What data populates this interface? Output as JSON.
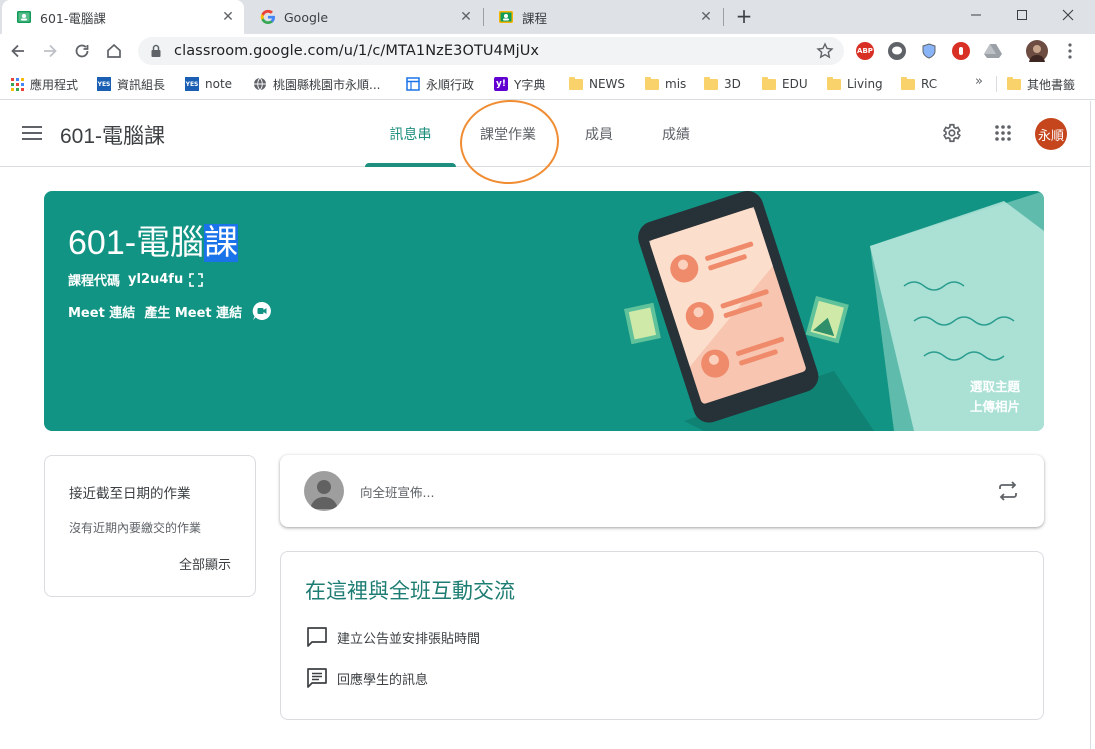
{
  "browser": {
    "tabs": [
      {
        "title": "601-電腦課",
        "active": true,
        "icon": "classroom-icon"
      },
      {
        "title": "Google",
        "active": false,
        "icon": "google-icon"
      },
      {
        "title": "課程",
        "active": false,
        "icon": "classroom-icon"
      }
    ],
    "url": "classroom.google.com/u/1/c/MTA1NzE3OTU4MjUx",
    "extensions": [
      "adblock-icon",
      "line-icon",
      "shield-extension-icon",
      "stop-extension-icon",
      "drive-icon",
      "profile-photo"
    ],
    "bookmarks": [
      {
        "label": "應用程式",
        "icon": "apps-grid-icon"
      },
      {
        "label": "資訊組長",
        "icon": "yes-icon"
      },
      {
        "label": "note",
        "icon": "yes-icon"
      },
      {
        "label": "桃園縣桃園市永順...",
        "icon": "globe-icon"
      },
      {
        "label": "永順行政",
        "icon": "window-icon"
      },
      {
        "label": "Y字典",
        "icon": "yahoo-icon"
      },
      {
        "label": "NEWS",
        "icon": "folder-icon"
      },
      {
        "label": "mis",
        "icon": "folder-icon"
      },
      {
        "label": "3D",
        "icon": "folder-icon"
      },
      {
        "label": "EDU",
        "icon": "folder-icon"
      },
      {
        "label": "Living",
        "icon": "folder-icon"
      },
      {
        "label": "RC",
        "icon": "folder-icon"
      }
    ],
    "more_bookmarks": "»",
    "other_bookmarks": "其他書籤"
  },
  "app": {
    "course_title": "601-電腦課",
    "tabs": [
      {
        "label": "訊息串",
        "active": true
      },
      {
        "label": "課堂作業",
        "active": false
      },
      {
        "label": "成員",
        "active": false
      },
      {
        "label": "成績",
        "active": false
      }
    ],
    "avatar_text": "永順"
  },
  "banner": {
    "title_prefix": "601-電腦",
    "title_highlight": "課",
    "code_label": "課程代碼",
    "code_value": "yl2u4fu",
    "meet_label": "Meet 連結",
    "meet_generate": "產生 Meet 連結",
    "select_theme": "選取主題",
    "upload_photo": "上傳相片",
    "color": "#129484"
  },
  "upcoming": {
    "title": "接近截至日期的作業",
    "empty_text": "沒有近期內要繳交的作業",
    "view_all": "全部顯示"
  },
  "announce": {
    "placeholder": "向全班宣佈..."
  },
  "interact": {
    "title": "在這裡與全班互動交流",
    "items": [
      {
        "label": "建立公告並安排張貼時間",
        "icon": "announcement-icon"
      },
      {
        "label": "回應學生的訊息",
        "icon": "message-icon"
      }
    ]
  },
  "colors": {
    "accent": "#1e8e7e",
    "annotation": "#f08c32"
  }
}
